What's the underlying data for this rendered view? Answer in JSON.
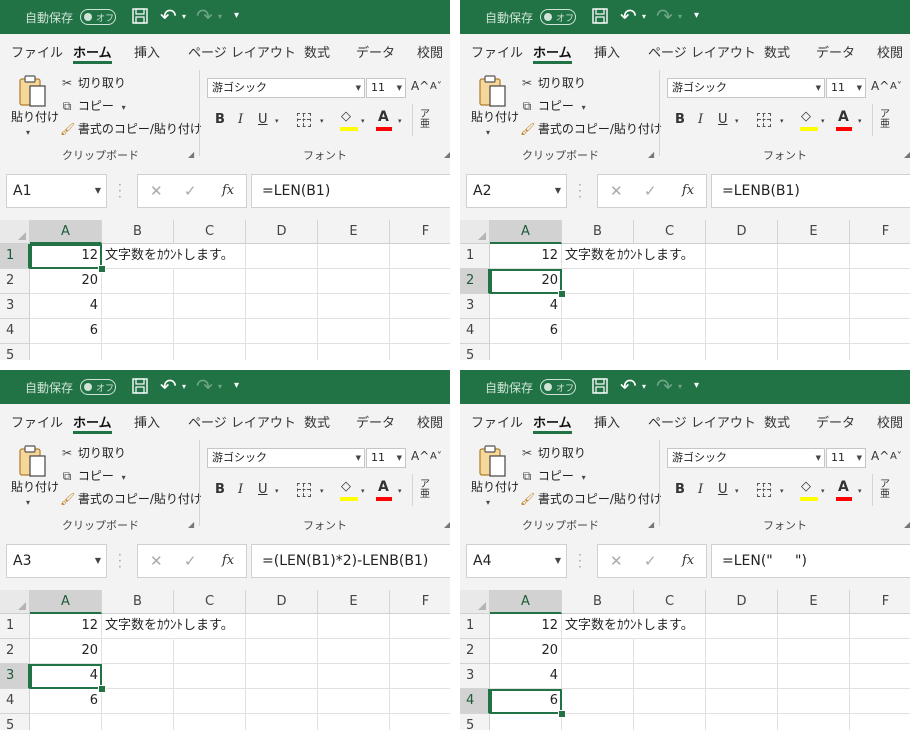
{
  "ui": {
    "autosave_label": "自動保存",
    "autosave_toggle": "オフ",
    "tabs": [
      "ファイル",
      "ホーム",
      "挿入",
      "ページ レイアウト",
      "数式",
      "データ",
      "校閲"
    ],
    "clipboard": {
      "paste": "貼り付け",
      "cut": "切り取り",
      "copy": "コピー",
      "format_painter": "書式のコピー/貼り付け",
      "group_label": "クリップボード"
    },
    "font": {
      "name": "游ゴシック",
      "size": "11",
      "group_label": "フォント",
      "bold": "B",
      "italic": "I",
      "underline": "U",
      "font_color_glyph": "A",
      "grow": "A^",
      "shrink": "A˅",
      "phonetic_top": "ア",
      "phonetic_bottom": "亜"
    },
    "formula_bar": {
      "fx": "fx",
      "cancel": "✕",
      "enter": "✓"
    },
    "columns": [
      "A",
      "B",
      "C",
      "D",
      "E",
      "F"
    ],
    "rows": [
      "1",
      "2",
      "3",
      "4",
      "5"
    ],
    "cells": {
      "A1": "12",
      "B1": "文字数をｶｳﾝﾄします。",
      "A2": "20",
      "A3": "4",
      "A4": "6"
    }
  },
  "colors": {
    "title_bar": "#217346",
    "selection": "#217346",
    "fill_color": "#FFFF00",
    "font_color": "#FF0000"
  },
  "panels": [
    {
      "active_cell": "A1",
      "active_row": 1,
      "formula": "=LEN(B1)"
    },
    {
      "active_cell": "A2",
      "active_row": 2,
      "formula": "=LENB(B1)"
    },
    {
      "active_cell": "A3",
      "active_row": 3,
      "formula": "=(LEN(B1)*2)-LENB(B1)"
    },
    {
      "active_cell": "A4",
      "active_row": 4,
      "formula": "=LEN(\"     \")"
    }
  ]
}
